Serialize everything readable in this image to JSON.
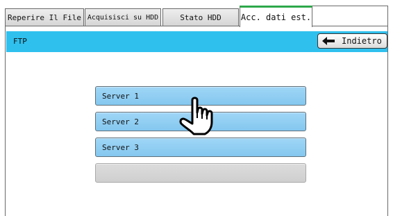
{
  "tabs": [
    {
      "label": "Reperire Il File",
      "active": false
    },
    {
      "label": "Acquisisci su HDD",
      "active": false
    },
    {
      "label": "Stato HDD",
      "active": false
    },
    {
      "label": "Acc. dati est.",
      "active": true
    }
  ],
  "header": {
    "title": "FTP",
    "back_label": "Indietro",
    "back_icon": "left-arrow-icon",
    "color": "#2fc0ee"
  },
  "servers": [
    {
      "label": "Server 1"
    },
    {
      "label": "Server 2"
    },
    {
      "label": "Server 3"
    },
    {
      "label": ""
    }
  ],
  "pointer_icon": "hand-pointer-icon",
  "colors": {
    "active_tab_accent": "#2ea84a",
    "server_button": "#8fcdf2",
    "empty_button": "#d6d6d6"
  }
}
